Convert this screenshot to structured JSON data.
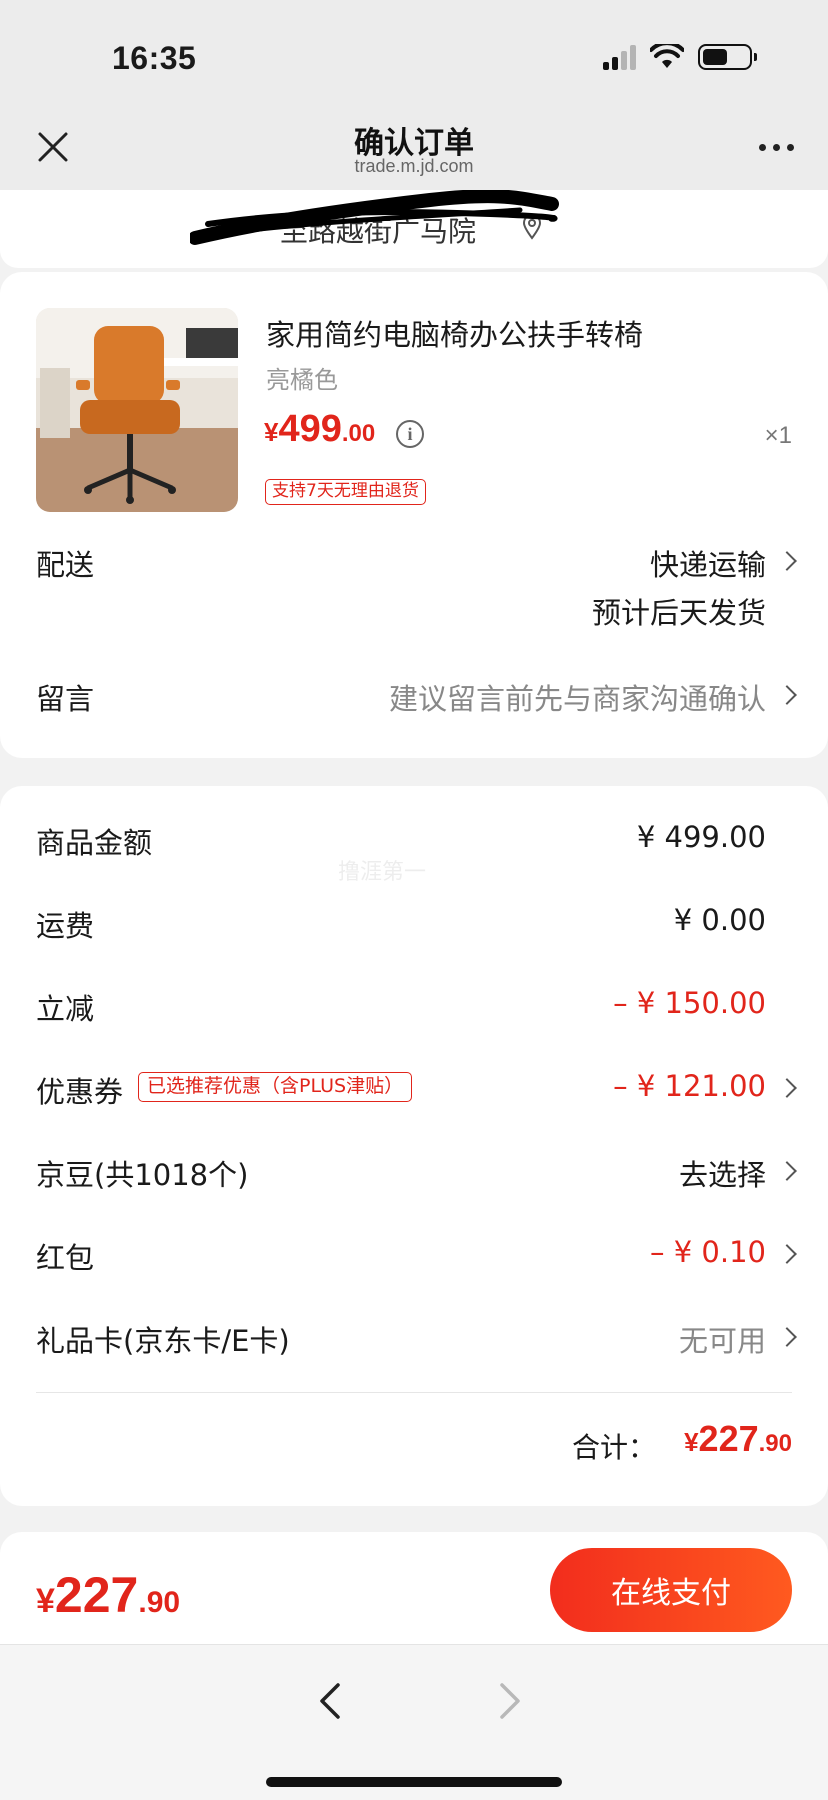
{
  "status_bar": {
    "time": "16:35"
  },
  "nav": {
    "title": "确认订单",
    "url": "trade.m.jd.com"
  },
  "address": {
    "text": "至路越街广马院"
  },
  "product": {
    "title": "家用简约电脑椅办公扶手转椅",
    "variant": "亮橘色",
    "price_currency": "¥",
    "price_int": "499",
    "price_dec": ".00",
    "quantity": "×1",
    "return_policy": "支持7天无理由退货"
  },
  "delivery": {
    "label": "配送",
    "method": "快递运输",
    "eta": "预计后天发货"
  },
  "message": {
    "label": "留言",
    "placeholder": "建议留言前先与商家沟通确认"
  },
  "summary": {
    "watermark": "撸涯第一",
    "items": [
      {
        "label": "商品金额",
        "value": "¥ 499.00"
      },
      {
        "label": "运费",
        "value": "¥ 0.00"
      },
      {
        "label": "立减",
        "value": "– ¥ 150.00"
      },
      {
        "label": "优惠券",
        "badge": "已选推荐优惠（含PLUS津贴）",
        "value": "– ¥ 121.00"
      },
      {
        "label": "京豆(共1018个)",
        "value": "去选择"
      },
      {
        "label": "红包",
        "value": "– ¥ 0.10"
      },
      {
        "label": "礼品卡(京东卡/E卡)",
        "value": "无可用"
      }
    ],
    "total_label": "合计：",
    "total_currency": "¥",
    "total_int": "227",
    "total_dec": ".90"
  },
  "checkout": {
    "currency": "¥",
    "amount_int": "227",
    "amount_dec": ".90",
    "pay_label": "在线支付"
  },
  "colors": {
    "accent_red": "#e1251b",
    "pay_gradient_start": "#f22d1d",
    "pay_gradient_end": "#ff5a1f"
  },
  "icons": [
    "close-icon",
    "more-icon",
    "location-pin-icon",
    "info-icon",
    "chevron-right-icon",
    "back-arrow-icon",
    "forward-arrow-icon"
  ]
}
